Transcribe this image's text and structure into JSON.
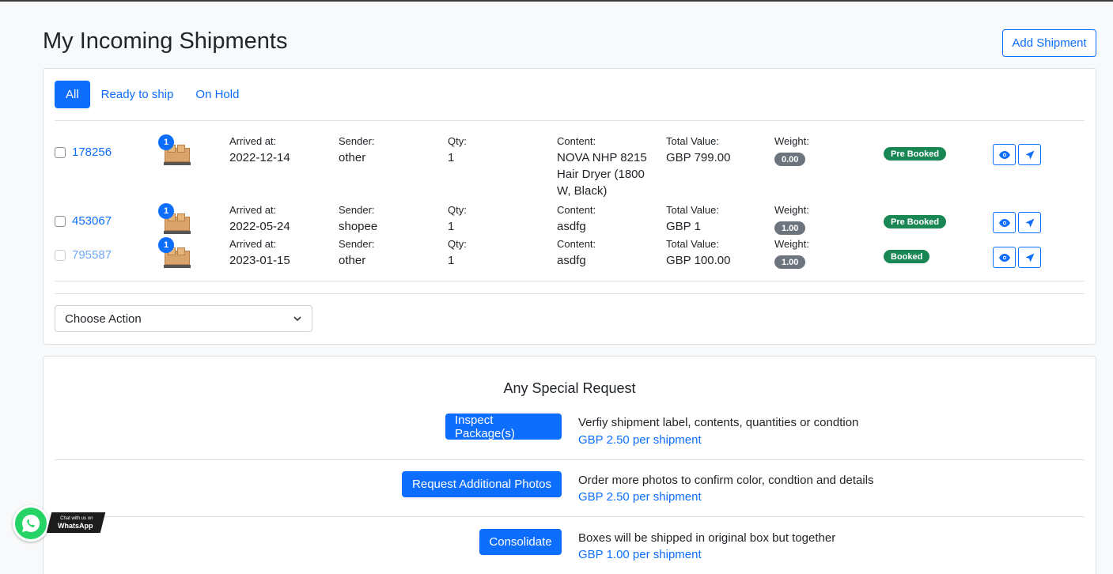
{
  "page": {
    "title": "My Incoming Shipments",
    "add_shipment_label": "Add Shipment"
  },
  "tabs": [
    {
      "label": "All",
      "active": true
    },
    {
      "label": "Ready to ship",
      "active": false
    },
    {
      "label": "On Hold",
      "active": false
    }
  ],
  "field_labels": {
    "arrived": "Arrived at:",
    "sender": "Sender:",
    "qty": "Qty:",
    "content": "Content:",
    "total_value": "Total Value:",
    "weight": "Weight:"
  },
  "shipments": [
    {
      "id": "178256",
      "count": "1",
      "arrived": "2022-12-14",
      "sender": "other",
      "qty": "1",
      "content": "NOVA NHP 8215 Hair Dryer (1800 W, Black)",
      "total_value": "GBP 799.00",
      "weight": "0.00",
      "status": "Pre Booked",
      "enabled": true
    },
    {
      "id": "453067",
      "count": "1",
      "arrived": "2022-05-24",
      "sender": "shopee",
      "qty": "1",
      "content": "asdfg",
      "total_value": "GBP 1",
      "weight": "1.00",
      "status": "Pre Booked",
      "enabled": true
    },
    {
      "id": "795587",
      "count": "1",
      "arrived": "2023-01-15",
      "sender": "other",
      "qty": "1",
      "content": "asdfg",
      "total_value": "GBP 100.00",
      "weight": "1.00",
      "status": "Booked",
      "enabled": false
    }
  ],
  "action_select": {
    "value": "Choose Action"
  },
  "special_request": {
    "title": "Any Special Request",
    "items": [
      {
        "button": "Inspect Package(s)",
        "description": "Verfiy shipment label, contents, quantities or condtion",
        "price": "GBP 2.50 per shipment"
      },
      {
        "button": "Request Additional Photos",
        "description": "Order more photos to confirm color, condtion and details",
        "price": "GBP 2.50 per shipment"
      },
      {
        "button": "Consolidate",
        "description": "Boxes will be shipped in original box but together",
        "price": "GBP 1.00 per shipment"
      }
    ]
  },
  "whatsapp": {
    "line1": "Chat with us on",
    "line2": "WhatsApp"
  },
  "colors": {
    "primary": "#0d6efd",
    "success": "#198754",
    "secondary": "#6c757d",
    "whatsapp": "#25d366"
  }
}
